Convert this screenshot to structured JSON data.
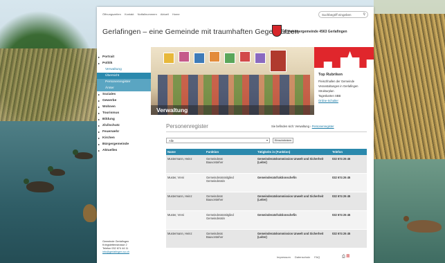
{
  "topnav": [
    "Öffnungszeiten",
    "Kontakt",
    "Notfallnummern",
    "Aktuell",
    "Home"
  ],
  "search": {
    "placeholder": "Suchbegriff eingeben",
    "icon": "search-icon"
  },
  "site_title": "Gerlafingen – eine Gemeinde mit traumhaften Gegensätzen",
  "crest_label": "Einwohnergemeinde 4563 Gerlafingen",
  "sidebar": {
    "items": [
      {
        "label": "Portrait",
        "type": "top"
      },
      {
        "label": "Politik",
        "type": "top"
      },
      {
        "label": "Verwaltung",
        "type": "sub"
      },
      {
        "label": "Übersicht",
        "type": "active"
      },
      {
        "label": "Personenregister",
        "type": "active2"
      },
      {
        "label": "Ämter",
        "type": "active2"
      },
      {
        "label": "Soziales",
        "type": "top"
      },
      {
        "label": "Gewerbe",
        "type": "top"
      },
      {
        "label": "Wohnen",
        "type": "top"
      },
      {
        "label": "Tourismus",
        "type": "top"
      },
      {
        "label": "Bildung",
        "type": "top"
      },
      {
        "label": "Zivilschutz",
        "type": "top"
      },
      {
        "label": "Feuerwehr",
        "type": "top"
      },
      {
        "label": "Kirchen",
        "type": "top"
      },
      {
        "label": "Bürgergemeinde",
        "type": "top"
      },
      {
        "label": "Aktuelles",
        "type": "top"
      }
    ]
  },
  "address": [
    "Gemeinde Gerlafingen",
    "Kriegstettenstrasse 2",
    "Telefon 032 674 44 11",
    "info@gerlafingen.so.ch"
  ],
  "hero": {
    "caption": "Verwaltung"
  },
  "top_rubriken": {
    "title": "Top Rubriken",
    "links": [
      "Fleischhallen der Gemeinde",
      "Veranstaltungen in Gerlafingen",
      "Strukturplan",
      "Tageskarten SBB",
      "Online-Schalter"
    ]
  },
  "register": {
    "heading": "Personenregister",
    "breadcrumb_prefix": "Sie befinden sich: Verwaltung",
    "breadcrumb_link": "Personenregister",
    "filter_value": "Alle",
    "filter_button": "Einschränken",
    "columns": [
      "Name",
      "Funktion",
      "Tätigkeits in (Funktion)",
      "Telefon"
    ],
    "rows": [
      {
        "name": "Mustermann, Heinz",
        "funktion": "Gemeinderat\nBauvorsteher",
        "taetigkeit": "Gemeinderatskommission Unwelt und Sicherheit (Leiter)",
        "telefon": "032 674 26 45"
      },
      {
        "name": "Muster, Vreni",
        "funktion": "Gemeinderatsmitglied\nGemeinderatin",
        "taetigkeit": "Gemeinderatsfraktionschefin",
        "telefon": "032 674 26 45"
      },
      {
        "name": "Mustermann, Heinz",
        "funktion": "Gemeinderat\nBauvorsteher",
        "taetigkeit": "Gemeinderatskommission Unwelt und Sicherheit (Leiter)",
        "telefon": "032 674 26 45"
      },
      {
        "name": "Muster, Vreni",
        "funktion": "Gemeinderatsmitglied\nGemeinderatin",
        "taetigkeit": "Gemeinderatsfraktionschefin",
        "telefon": "032 674 26 45"
      },
      {
        "name": "Mustermann, Heinz",
        "funktion": "Gemeinderat\nBauvorsteher",
        "taetigkeit": "Gemeinderatskommission Unwelt und Sicherheit (Leiter)",
        "telefon": "032 674 26 45"
      }
    ]
  },
  "footer_links": [
    "Impressum",
    "Datenschutz",
    "FAQ"
  ],
  "footer_icons": [
    "print-icon",
    "pdf-icon"
  ],
  "colors": {
    "accent": "#2b89ad",
    "brand_red": "#e0262c"
  }
}
